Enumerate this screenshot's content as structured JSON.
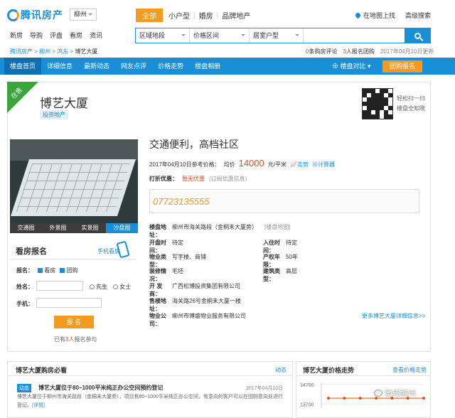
{
  "header": {
    "logo_text": "腾讯房产",
    "city": "柳州",
    "nav": [
      "新房",
      "导购",
      "评盘",
      "看房",
      "资讯"
    ],
    "tabs": [
      "全部",
      "小户型",
      "婚房",
      "品牌地产"
    ],
    "map_search": "在地图上找",
    "advanced_search": "高级搜索",
    "filters": [
      "区域地段",
      "价格区间",
      "居室户型"
    ],
    "search_placeholder": ""
  },
  "breadcrumb": [
    "腾讯房产",
    "柳州",
    "鸿东",
    "博艺大厦"
  ],
  "stats": {
    "reviews_count": "0",
    "reviews_label": "条购房评论",
    "group_count": "3",
    "group_label": "人报名团购",
    "date": "2017年04月10日更新"
  },
  "mainnav": {
    "items": [
      "楼盘首页",
      "详细信息",
      "最新动态",
      "网友点评",
      "价格走势",
      "楼盘相册"
    ],
    "compare": "楼盘对比",
    "signup": "团购报名"
  },
  "property": {
    "badge": "在售",
    "name": "博艺大厦",
    "tag": "投资地产",
    "qr_text": "轻松扫一扫 楼盘全知晓",
    "photo_tabs": [
      "交通图",
      "外景图",
      "实景图",
      "沙盘图"
    ],
    "slogan": "交通便利，高档社区",
    "price_date_label": "2017年04月10日参考价格：",
    "price_prefix": "均价",
    "price": "14000",
    "price_unit": "元/平米",
    "trend_link": "走势",
    "calc_link": "计算器",
    "discount_label": "打折优惠：",
    "discount_value": "暂无优惠",
    "discount_sub": "(订阅优惠信息)",
    "phone": "07723135555",
    "address_label": "楼盘地址：",
    "address": "柳州市海关路段（金桐未大厦旁）",
    "map_link": "[楼盘地图]",
    "open_label": "开盘时间：",
    "open": "待定",
    "checkin_label": "入住时间：",
    "checkin": "待定",
    "type_label": "物业类型：",
    "type": "写字楼、商铺",
    "rights_label": "产权年限：",
    "rights": "50年",
    "deco_label": "装修情况：",
    "deco": "毛坯",
    "build_label": "建筑类型：",
    "build": "高层",
    "dev_label": "开 发 商：",
    "dev": "广西松博投资集团有限公司",
    "sales_label": "售楼地址：",
    "sales": "海关路26号金桐未大厦一楼",
    "pm_label": "物业公司：",
    "pm": "柳州市博盛物业服务有限公司",
    "more_link": "更多博艺大厦详细信息>>"
  },
  "form": {
    "title": "看房报名",
    "mobile": "手机看房",
    "signup_label": "报名：",
    "opt1": "看房",
    "opt2": "团购",
    "name_label": "姓名：",
    "sir": "先生",
    "madam": "女士",
    "phone_label": "手机：",
    "submit": "报 名",
    "applied_pre": "已有",
    "applied_num": "3人",
    "applied_post": "报名参与"
  },
  "news": {
    "title": "博艺大厦购房必看",
    "more": "动态",
    "tag": "动态",
    "item_title": "博艺大厦位于80~1000平米纯正办公空间预约登记",
    "item_date": "2017年04月10日",
    "item_body": "博艺大厦位于柳州市海关路段（金桐未大厦旁），项目有80~1000平米纯正办公空间，有意向的客户可以在团购意向处进行登记。",
    "item_link": "[详情]"
  },
  "price_panel": {
    "title": "博艺大厦价格走势",
    "more": "查看价格走势"
  },
  "chart_data": {
    "type": "line",
    "title": "",
    "ytick_labels": [
      "14700",
      "13700"
    ],
    "ylim": [
      13500,
      14800
    ],
    "values": [
      14000,
      14000,
      14000,
      14000,
      14000,
      14000,
      14000
    ]
  },
  "watermark": "微邦柳州",
  "colors": {
    "primary": "#1a8fd9",
    "accent": "#f39b1f",
    "price": "#e2521f",
    "badge": "#3aa53a"
  }
}
